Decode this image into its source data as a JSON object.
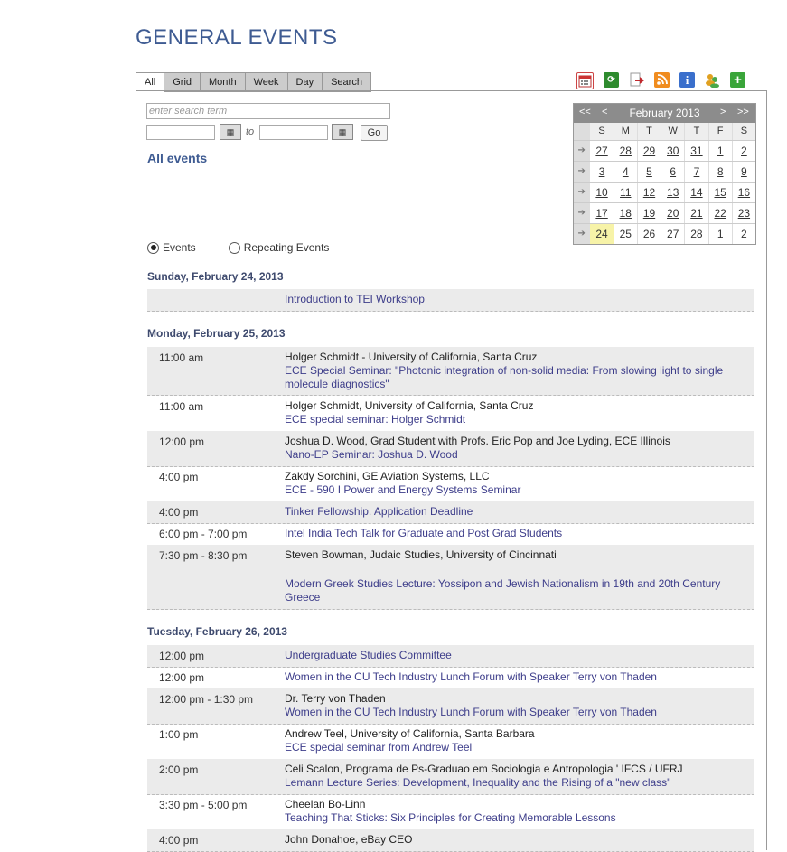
{
  "page_title": "GENERAL EVENTS",
  "tabs": [
    "All",
    "Grid",
    "Month",
    "Week",
    "Day",
    "Search"
  ],
  "toolbar_icons": [
    "calendar-icon",
    "sync-icon",
    "export-icon",
    "rss-icon",
    "info-icon",
    "users-icon",
    "add-icon"
  ],
  "search": {
    "placeholder": "enter search term",
    "to_label": "to",
    "go_label": "Go",
    "calendar_glyph": "▦"
  },
  "all_events_label": "All events",
  "mini_calendar": {
    "prev_year": "<<",
    "prev": "<",
    "month": "February 2013",
    "next": ">",
    "next_year": ">>",
    "dow": [
      "S",
      "M",
      "T",
      "W",
      "T",
      "F",
      "S"
    ],
    "week_arrow": "➔",
    "weeks": [
      [
        "27",
        "28",
        "29",
        "30",
        "31",
        "1",
        "2"
      ],
      [
        "3",
        "4",
        "5",
        "6",
        "7",
        "8",
        "9"
      ],
      [
        "10",
        "11",
        "12",
        "13",
        "14",
        "15",
        "16"
      ],
      [
        "17",
        "18",
        "19",
        "20",
        "21",
        "22",
        "23"
      ],
      [
        "24",
        "25",
        "26",
        "27",
        "28",
        "1",
        "2"
      ]
    ],
    "today": "24"
  },
  "view": {
    "events_label": "Events",
    "repeating_label": "Repeating Events"
  },
  "days": [
    {
      "label": "Sunday, February 24, 2013",
      "events": [
        {
          "time": "",
          "speaker": "",
          "link": "Introduction to TEI Workshop"
        }
      ]
    },
    {
      "label": "Monday, February 25, 2013",
      "events": [
        {
          "time": "11:00 am",
          "speaker": "Holger Schmidt - University of California, Santa Cruz",
          "link": "ECE Special Seminar: \"Photonic integration of non-solid media: From slowing light to single molecule diagnostics\""
        },
        {
          "time": "11:00 am",
          "speaker": "Holger Schmidt, University of California, Santa Cruz",
          "link": "ECE special seminar: Holger Schmidt"
        },
        {
          "time": "12:00 pm",
          "speaker": "Joshua D. Wood, Grad Student with Profs. Eric Pop and Joe Lyding, ECE Illinois",
          "link": "Nano-EP Seminar: Joshua D. Wood"
        },
        {
          "time": "4:00 pm",
          "speaker": "Zakdy Sorchini, GE Aviation Systems, LLC",
          "link": "ECE - 590 I Power and Energy Systems Seminar"
        },
        {
          "time": "4:00 pm",
          "speaker": "",
          "link": "Tinker Fellowship. Application Deadline"
        },
        {
          "time": "6:00 pm - 7:00 pm",
          "speaker": "",
          "link": "Intel India Tech Talk for Graduate and Post Grad Students"
        },
        {
          "time": "7:30 pm - 8:30 pm",
          "speaker": "Steven Bowman, Judaic Studies, University of Cincinnati",
          "link": "Modern Greek Studies Lecture: Yossipon and Jewish Nationalism in 19th and 20th Century Greece"
        }
      ]
    },
    {
      "label": "Tuesday, February 26, 2013",
      "events": [
        {
          "time": "12:00 pm",
          "speaker": "",
          "link": "Undergraduate Studies Committee"
        },
        {
          "time": "12:00 pm",
          "speaker": "",
          "link": "Women in the CU Tech Industry Lunch Forum with Speaker Terry von Thaden"
        },
        {
          "time": "12:00 pm - 1:30 pm",
          "speaker": "Dr. Terry von Thaden",
          "link": "Women in the CU Tech Industry Lunch Forum with Speaker Terry von Thaden"
        },
        {
          "time": "1:00 pm",
          "speaker": "Andrew Teel, University of California, Santa Barbara",
          "link": "ECE special seminar from Andrew Teel"
        },
        {
          "time": "2:00 pm",
          "speaker": "Celi Scalon, Programa de Ps-Graduao em Sociologia e Antropologia ' IFCS / UFRJ",
          "link": "Lemann Lecture Series: Development, Inequality and the Rising of a \"new class\""
        },
        {
          "time": "3:30 pm - 5:00 pm",
          "speaker": "Cheelan Bo-Linn",
          "link": "Teaching That Sticks: Six Principles for Creating Memorable Lessons"
        },
        {
          "time": "4:00 pm",
          "speaker": "John Donahoe, eBay CEO",
          "link": ""
        }
      ]
    }
  ]
}
